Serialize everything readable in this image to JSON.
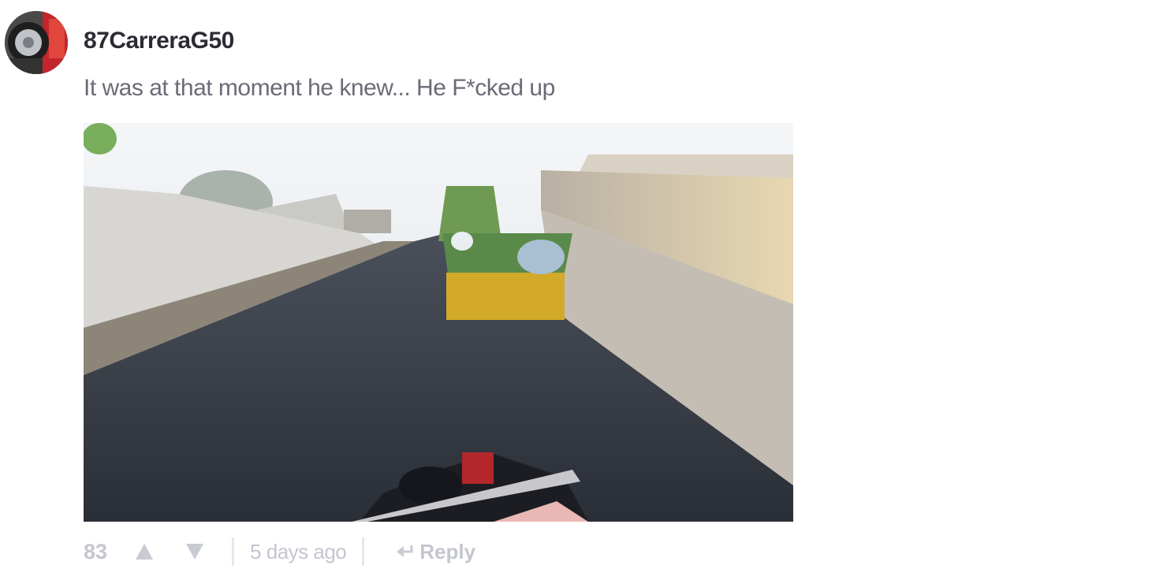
{
  "comment": {
    "author": {
      "username": "87CarreraG50",
      "avatar_icon": "user-avatar"
    },
    "text": "It was at that moment he knew... He F*cked up",
    "media": {
      "type": "video-thumbnail"
    },
    "actions": {
      "score": "83",
      "upvote_icon": "triangle-up-icon",
      "downvote_icon": "triangle-down-icon",
      "timestamp": "5 days ago",
      "reply_icon": "reply-arrow-icon",
      "reply_label": "Reply"
    }
  },
  "colors": {
    "username": "#2b2b33",
    "text": "#6b6b78",
    "muted": "#c4c6cf"
  }
}
